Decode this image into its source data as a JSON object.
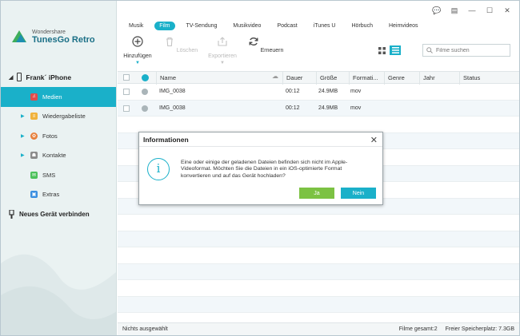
{
  "app": {
    "brand": "Wondershare",
    "product": "TunesGo Retro"
  },
  "sidebar": {
    "device_name": "Frank´ iPhone",
    "items": [
      {
        "label": "Medien",
        "icon": "music-icon",
        "color": "#e04b4b"
      },
      {
        "label": "Wiedergabeliste",
        "icon": "playlist-icon",
        "color": "#f0b23c"
      },
      {
        "label": "Fotos",
        "icon": "photos-icon",
        "color": "#e77f3b"
      },
      {
        "label": "Kontakte",
        "icon": "contacts-icon",
        "color": "#8b8b8b"
      },
      {
        "label": "SMS",
        "icon": "sms-icon",
        "color": "#4cc15b"
      },
      {
        "label": "Extras",
        "icon": "extras-icon",
        "color": "#3b8fe0"
      }
    ],
    "connect_label": "Neues Gerät verbinden"
  },
  "tabs": [
    "Musik",
    "Film",
    "TV-Sendung",
    "Musikvideo",
    "Podcast",
    "iTunes U",
    "Hörbuch",
    "Heimvideos"
  ],
  "active_tab": "Film",
  "toolbar": {
    "add": "Hinzufügen",
    "delete": "Löschen",
    "export": "Exportieren",
    "refresh": "Erneuern"
  },
  "search": {
    "placeholder": "Filme suchen"
  },
  "table": {
    "columns": [
      "Name",
      "Dauer",
      "Größe",
      "Formati...",
      "Genre",
      "Jahr",
      "Status"
    ],
    "rows": [
      {
        "name": "IMG_0038",
        "duration": "00:12",
        "size": "24.9MB",
        "format": "mov"
      },
      {
        "name": "IMG_0038",
        "duration": "00:12",
        "size": "24.9MB",
        "format": "mov"
      }
    ]
  },
  "status": {
    "selection": "Nichts ausgewählt",
    "total": "Filme gesamt:2",
    "free": "Freier Speicherplatz: 7.3GB"
  },
  "dialog": {
    "title": "Informationen",
    "message": "Eine oder einige der geladenen Dateien befinden sich nicht im Apple-Videoformat. Möchten Sie die Dateien in ein iOS-optimierte Format konvertieren und auf das Gerät hochladen?",
    "yes": "Ja",
    "no": "Nein"
  },
  "colors": {
    "accent": "#1ab0c9",
    "yes_button": "#7cc243"
  }
}
